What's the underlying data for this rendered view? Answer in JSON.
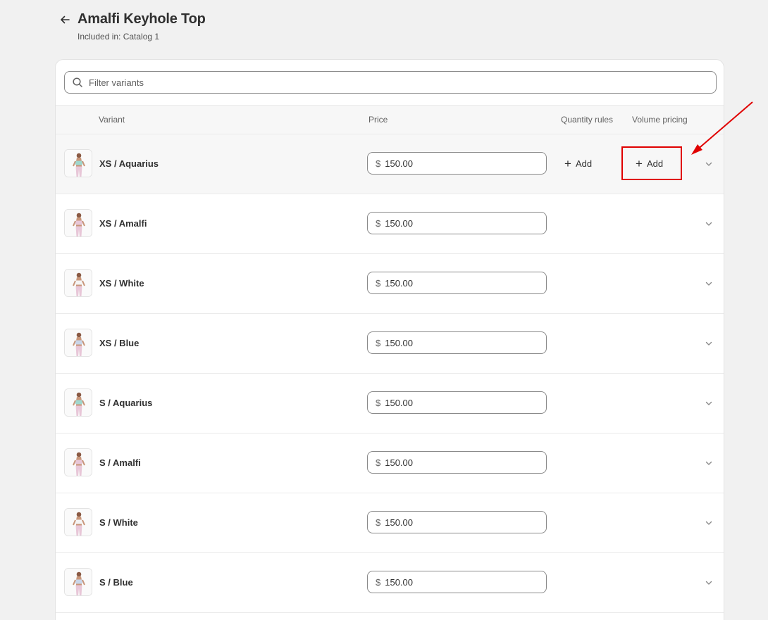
{
  "header": {
    "title": "Amalfi Keyhole Top",
    "subtitle": "Included in: Catalog 1"
  },
  "search": {
    "placeholder": "Filter variants"
  },
  "columns": {
    "variant": "Variant",
    "price": "Price",
    "quantity_rules": "Quantity rules",
    "volume_pricing": "Volume pricing"
  },
  "add_label": "Add",
  "currency_symbol": "$",
  "variants": [
    {
      "name": "XS / Aquarius",
      "price": "150.00",
      "color": "#9fd8cf"
    },
    {
      "name": "XS / Amalfi",
      "price": "150.00",
      "color": "#e8c7d8"
    },
    {
      "name": "XS / White",
      "price": "150.00",
      "color": "#f5f5f5"
    },
    {
      "name": "XS / Blue",
      "price": "150.00",
      "color": "#c9d6ea"
    },
    {
      "name": "S / Aquarius",
      "price": "150.00",
      "color": "#9fd8cf"
    },
    {
      "name": "S / Amalfi",
      "price": "150.00",
      "color": "#e8c7d8"
    },
    {
      "name": "S / White",
      "price": "150.00",
      "color": "#f5f5f5"
    },
    {
      "name": "S / Blue",
      "price": "150.00",
      "color": "#c9d6ea"
    }
  ],
  "highlight_color": "#e00000"
}
